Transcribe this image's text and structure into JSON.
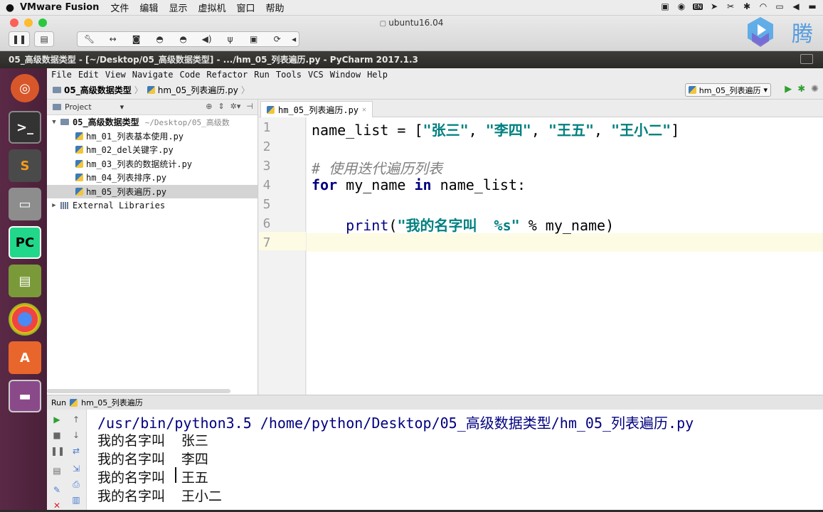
{
  "mac_menubar": {
    "app_name": "VMware Fusion",
    "items": [
      "文件",
      "编辑",
      "显示",
      "虚拟机",
      "窗口",
      "帮助"
    ],
    "tray_icons": [
      "camera-icon",
      "mic-icon",
      "input-en-icon",
      "location-arrow-icon",
      "tools-icon",
      "bluetooth-icon",
      "wifi-icon",
      "airplay-icon",
      "volume-icon",
      "battery-icon"
    ],
    "input_label": "EN"
  },
  "vmware": {
    "window_title": "ubuntu16.04",
    "watermark_text": "腾"
  },
  "ubuntu_titlebar": {
    "title": "05_高级数据类型 - [~/Desktop/05_高级数据类型] - .../hm_05_列表遍历.py - PyCharm 2017.1.3"
  },
  "launcher": {
    "items": [
      "ubuntu-dash-icon",
      "terminal-icon",
      "sublime-text-icon",
      "files-icon",
      "pycharm-icon",
      "book-reader-icon",
      "chrome-icon",
      "software-center-icon",
      "workspace-icon"
    ]
  },
  "pycharm": {
    "menu": [
      "File",
      "Edit",
      "View",
      "Navigate",
      "Code",
      "Refactor",
      "Run",
      "Tools",
      "VCS",
      "Window",
      "Help"
    ],
    "breadcrumb": [
      "05_高级数据类型",
      "hm_05_列表遍历.py"
    ],
    "run_config": "hm_05_列表遍历",
    "project_panel": {
      "label": "Project",
      "root": {
        "name": "05_高级数据类型",
        "path": "~/Desktop/05_高级数"
      },
      "files": [
        "hm_01_列表基本使用.py",
        "hm_02_del关键字.py",
        "hm_03_列表的数据统计.py",
        "hm_04_列表排序.py",
        "hm_05_列表遍历.py"
      ],
      "selected_index": 4,
      "libraries": "External Libraries"
    },
    "editor": {
      "tab_label": "hm_05_列表遍历.py",
      "line_numbers": [
        "1",
        "2",
        "3",
        "4",
        "5",
        "6",
        "7"
      ],
      "current_line": 7,
      "code": {
        "l1_var": "name_list = [",
        "l1_s1": "\"张三\"",
        "l1_s2": "\"李四\"",
        "l1_s3": "\"王五\"",
        "l1_s4": "\"王小二\"",
        "l1_sep": ", ",
        "l1_end": "]",
        "l3_comment": "# 使用迭代遍历列表",
        "l4_for": "for",
        "l4_mid": " my_name ",
        "l4_in": "in",
        "l4_end": " name_list:",
        "l6_indent": "    ",
        "l6_fn": "print",
        "l6_open": "(",
        "l6_str": "\"我的名字叫  %s\"",
        "l6_rest": " % my_name)"
      }
    },
    "run_panel": {
      "label": "Run",
      "config": "hm_05_列表遍历",
      "command": "/usr/bin/python3.5 /home/python/Desktop/05_高级数据类型/hm_05_列表遍历.py",
      "output": [
        "我的名字叫  张三",
        "我的名字叫  李四",
        "我的名字叫  王五",
        "我的名字叫  王小二"
      ]
    }
  }
}
